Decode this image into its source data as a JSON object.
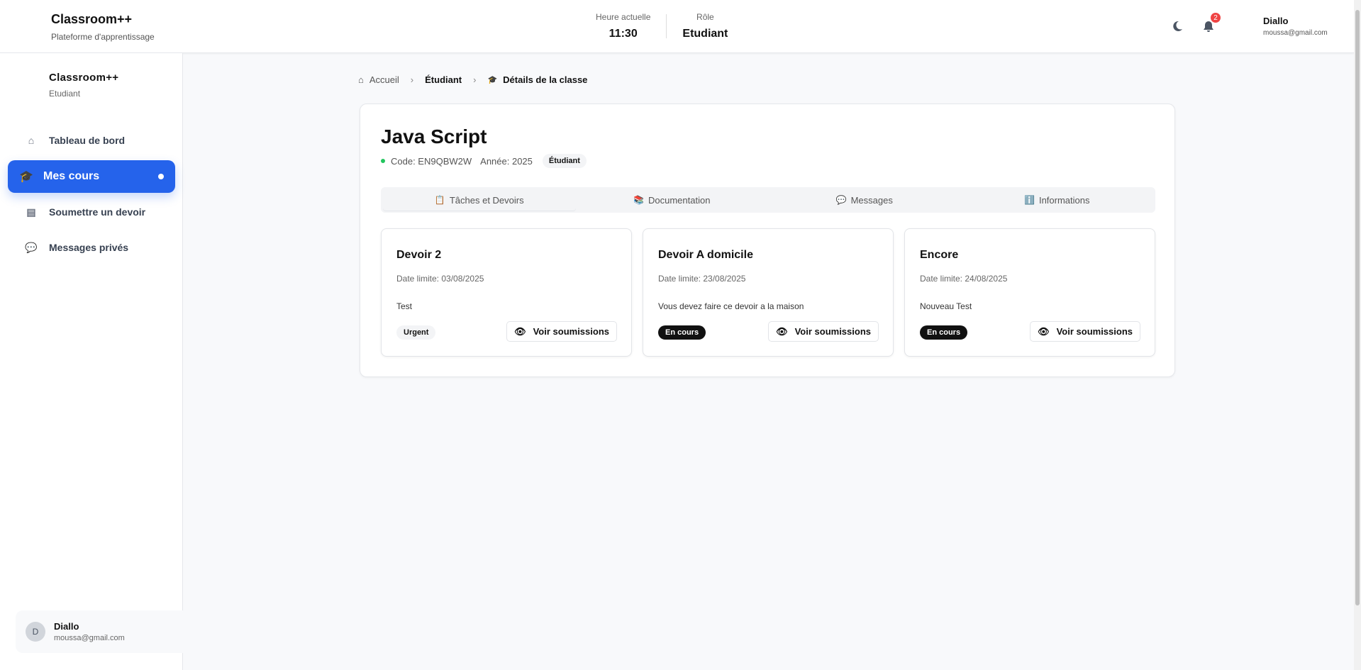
{
  "header": {
    "brand": "Classroom++",
    "subtitle": "Plateforme d'apprentissage",
    "time_label": "Heure actuelle",
    "time": "11:30",
    "role_label": "Rôle",
    "role": "Etudiant",
    "notif_count": "2",
    "user_name": "Diallo",
    "user_email": "moussa@gmail.com"
  },
  "sidebar": {
    "brand": "Classroom++",
    "role": "Etudiant",
    "items": [
      {
        "label": "Tableau de bord",
        "icon": "home-icon"
      },
      {
        "label": "Mes cours",
        "icon": "graduation-cap-icon"
      },
      {
        "label": "Soumettre un devoir",
        "icon": "file-icon"
      },
      {
        "label": "Messages privés",
        "icon": "comments-icon"
      }
    ],
    "user": {
      "initial": "D",
      "name": "Diallo",
      "email": "moussa@gmail.com"
    }
  },
  "breadcrumb": [
    "Accueil",
    "Étudiant",
    "Détails de la classe"
  ],
  "course": {
    "title": "Java Script",
    "code": "Code: EN9QBW2W",
    "year": "Année: 2025",
    "badge": "Étudiant"
  },
  "tabs": [
    {
      "label": "Tâches et Devoirs",
      "icon": "📋"
    },
    {
      "label": "Documentation",
      "icon": "📚"
    },
    {
      "label": "Messages",
      "icon": "💬"
    },
    {
      "label": "Informations",
      "icon": "ℹ️"
    }
  ],
  "tasks": [
    {
      "title": "Devoir 2",
      "deadline": "Date limite: 03/08/2025",
      "description": "Test",
      "status": "Urgent",
      "button": "Voir soumissions"
    },
    {
      "title": "Devoir A domicile",
      "deadline": "Date limite: 23/08/2025",
      "description": "Vous devez faire ce devoir a la maison",
      "status": "En cours",
      "button": "Voir soumissions"
    },
    {
      "title": "Encore",
      "deadline": "Date limite: 24/08/2025",
      "description": "Nouveau Test",
      "status": "En cours",
      "button": "Voir soumissions"
    }
  ]
}
